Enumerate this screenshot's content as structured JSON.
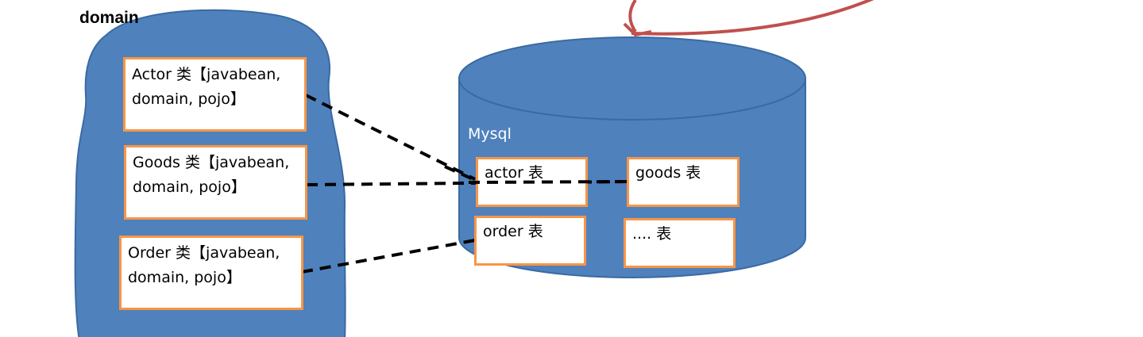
{
  "domain_label": "domain",
  "db_label": "Mysql",
  "classes": [
    {
      "line1": "Actor 类【javabean,",
      "line2": "domain, pojo】"
    },
    {
      "line1": "Goods 类【javabean,",
      "line2": "domain, pojo】"
    },
    {
      "line1": "Order 类【javabean,",
      "line2": "domain, pojo】"
    }
  ],
  "tables": [
    "actor 表",
    "goods 表",
    "order 表",
    ".... 表"
  ],
  "colors": {
    "shape_fill": "#4f81bd",
    "shape_stroke": "#3a6aa3",
    "box_border": "#f79646",
    "arrow": "#c0504d"
  }
}
